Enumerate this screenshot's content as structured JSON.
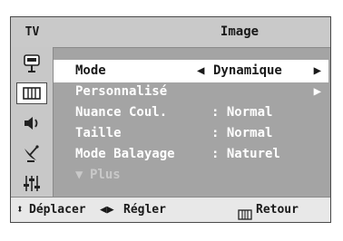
{
  "header": {
    "source_label": "TV",
    "page_title": "Image"
  },
  "sidebar": {
    "items": [
      {
        "icon": "antenna-icon",
        "active": false
      },
      {
        "icon": "picture-icon",
        "active": true
      },
      {
        "icon": "speaker-icon",
        "active": false
      },
      {
        "icon": "satellite-dish-icon",
        "active": false
      },
      {
        "icon": "equalizer-sliders-icon",
        "active": false
      }
    ]
  },
  "menu": {
    "mode": {
      "label": "Mode",
      "value": "Dynamique",
      "arrow_left": "◀",
      "arrow_right": "▶"
    },
    "custom": {
      "label": "Personnalisé",
      "arrow_right": "▶"
    },
    "color_tone": {
      "label": "Nuance Coul.",
      "value": ": Normal"
    },
    "size": {
      "label": "Taille",
      "value": ": Normal"
    },
    "scan_mode": {
      "label": "Mode Balayage",
      "value": ": Naturel"
    },
    "more": {
      "arrow": "▼",
      "label": "Plus"
    }
  },
  "status_bar": {
    "move_arrows": "⬍",
    "move_label": "Déplacer",
    "adjust_arrows": "◀▶",
    "adjust_label": "Régler",
    "return_label": "Retour"
  },
  "colors": {
    "panel": "#a4a4a4",
    "title_bar": "#c9c9c9",
    "highlight": "#ffffff",
    "status_bar": "#e8e8e8"
  }
}
